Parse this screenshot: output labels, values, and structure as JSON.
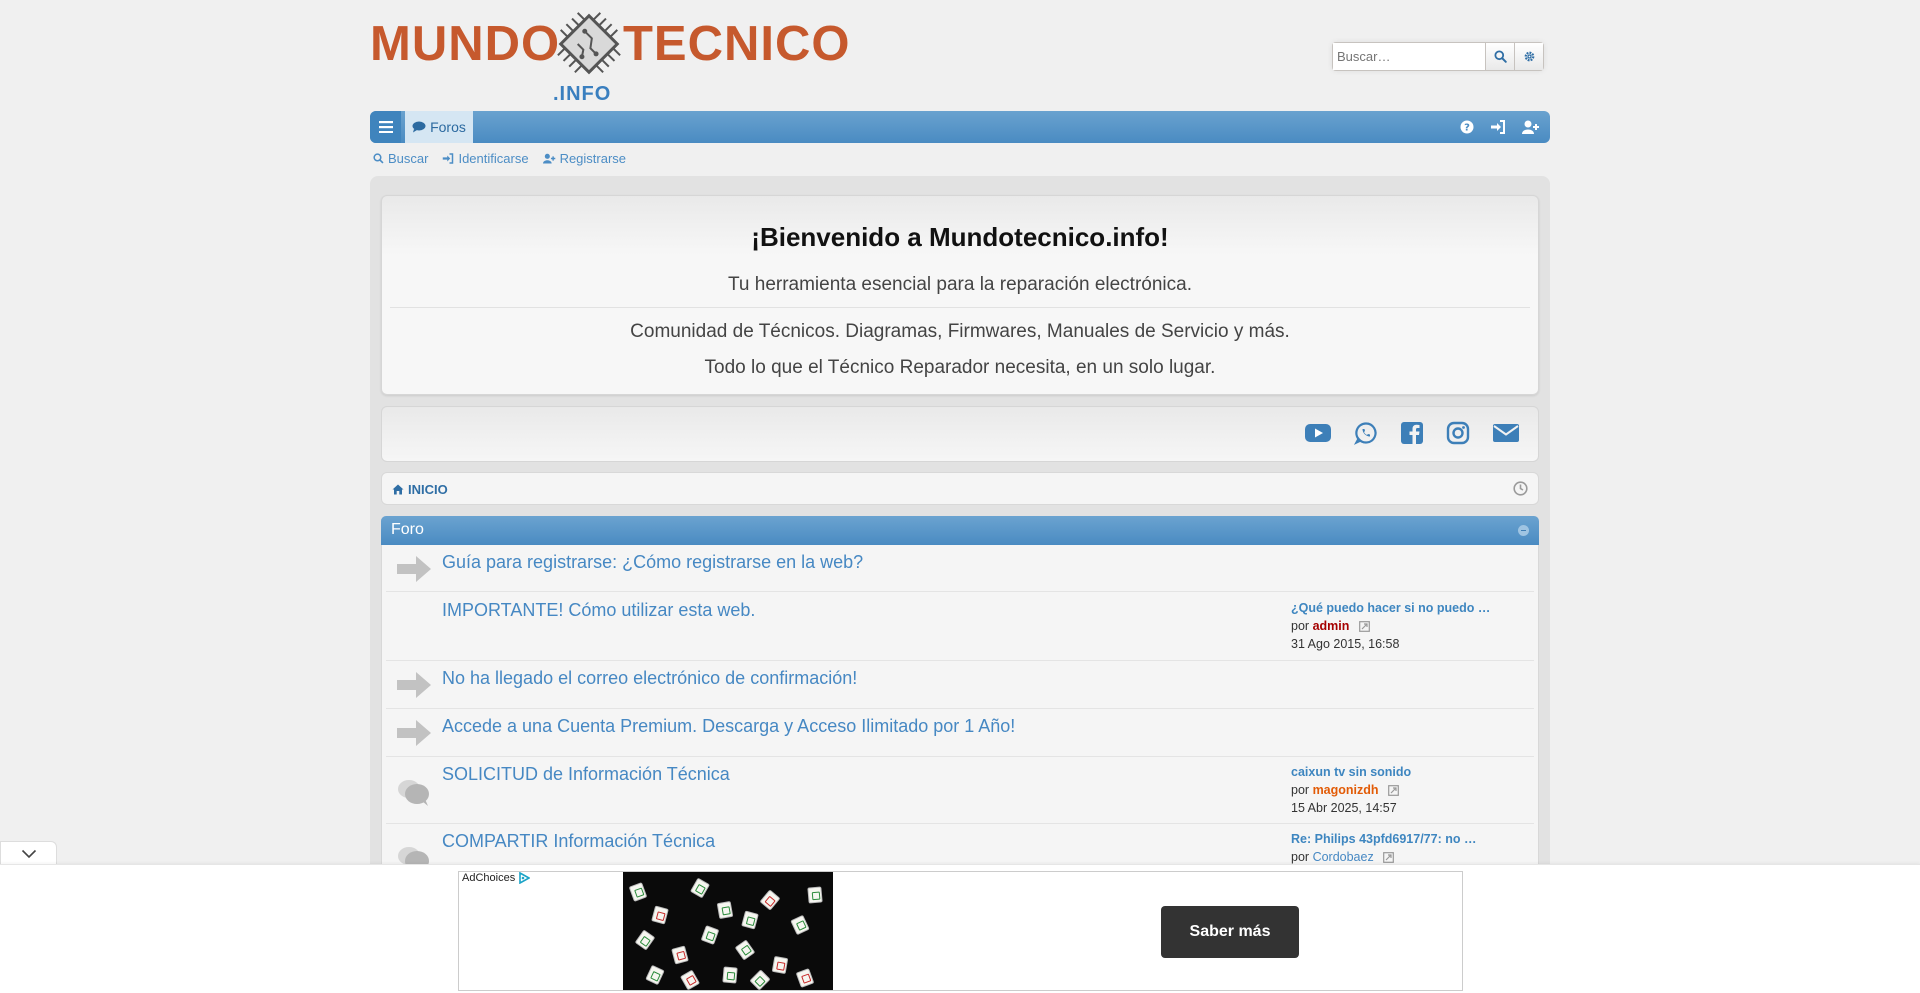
{
  "header": {
    "logo_left": "MUNDO",
    "logo_right": "TECNICO",
    "logo_suffix": ".INFO",
    "search_placeholder": "Buscar…"
  },
  "navbar": {
    "foros_label": "Foros"
  },
  "quick_links": {
    "search": "Buscar",
    "login": "Identificarse",
    "register": "Registrarse"
  },
  "welcome": {
    "title": "¡Bienvenido a Mundotecnico.info!",
    "subtitle": "Tu herramienta esencial para la reparación electrónica.",
    "line1": "Comunidad de Técnicos. Diagramas, Firmwares, Manuales de Servicio y más.",
    "line2": "Todo lo que el Técnico Reparador necesita, en un solo lugar."
  },
  "social": [
    "youtube-icon",
    "whatsapp-icon",
    "facebook-icon",
    "instagram-icon",
    "envelope-icon"
  ],
  "breadcrumb": {
    "home": "INICIO"
  },
  "forum": {
    "header": "Foro",
    "rows": [
      {
        "title": "Guía para registrarse: ¿Cómo registrarse en la web?",
        "icon": "arrow-icon"
      },
      {
        "title": "IMPORTANTE! Cómo utilizar esta web.",
        "icon": "none",
        "last_post_title": "¿Qué puedo hacer si no puedo …",
        "by": "por",
        "author": "admin",
        "date": "31 Ago 2015, 16:58"
      },
      {
        "title": "No ha llegado el correo electrónico de confirmación!",
        "icon": "arrow-icon"
      },
      {
        "title": "Accede a una Cuenta Premium. Descarga y Acceso Ilimitado por 1 Año!",
        "icon": "arrow-icon"
      },
      {
        "title": "SOLICITUD de Información Técnica",
        "icon": "bubbles-icon",
        "last_post_title": "caixun tv sin sonido",
        "by": "por",
        "author": "magonizdh",
        "date": "15 Abr 2025, 14:57"
      },
      {
        "title": "COMPARTIR Información Técnica",
        "icon": "bubbles-icon",
        "last_post_title": "Re: Philips 43pfd6917/77: no …",
        "by": "por",
        "author": "Cordobaez"
      }
    ]
  },
  "ad": {
    "adchoices": "AdChoices",
    "cta": "Saber más"
  },
  "colors": {
    "accent": "#4a8bc2",
    "logo": "#c6592d",
    "admin": "#a50000",
    "moderator": "#e25b06"
  }
}
